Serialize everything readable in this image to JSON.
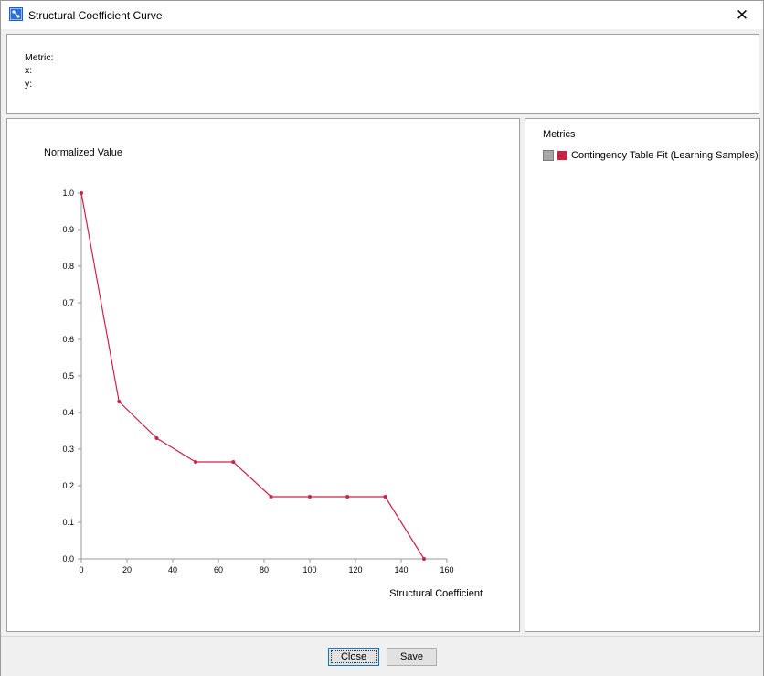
{
  "window": {
    "title": "Structural Coefficient Curve",
    "close_glyph": "✕"
  },
  "info": {
    "metric_label": "Metric:",
    "x_label": "x:",
    "y_label": "y:"
  },
  "legend": {
    "title": "Metrics",
    "items": [
      {
        "label": "Contingency Table Fit (Learning Samples)",
        "color": "#cc2244"
      }
    ]
  },
  "buttons": {
    "close_label": "Close",
    "save_label": "Save"
  },
  "chart_data": {
    "type": "line",
    "ylabel": "Normalized Value",
    "xlabel": "Structural Coefficient",
    "xlim": [
      0,
      160
    ],
    "ylim": [
      0.0,
      1.0
    ],
    "x_ticks": [
      0,
      20,
      40,
      60,
      80,
      100,
      120,
      140,
      160
    ],
    "y_ticks": [
      "0.0",
      "0.1",
      "0.2",
      "0.3",
      "0.4",
      "0.5",
      "0.6",
      "0.7",
      "0.8",
      "0.9",
      "1.0"
    ],
    "series": [
      {
        "name": "Contingency Table Fit (Learning Samples)",
        "color": "#cc2244",
        "x": [
          0,
          16.5,
          33,
          50,
          66.5,
          83,
          100,
          116.5,
          133,
          150
        ],
        "y": [
          1.0,
          0.43,
          0.33,
          0.265,
          0.265,
          0.17,
          0.17,
          0.17,
          0.17,
          0.0
        ]
      }
    ]
  }
}
